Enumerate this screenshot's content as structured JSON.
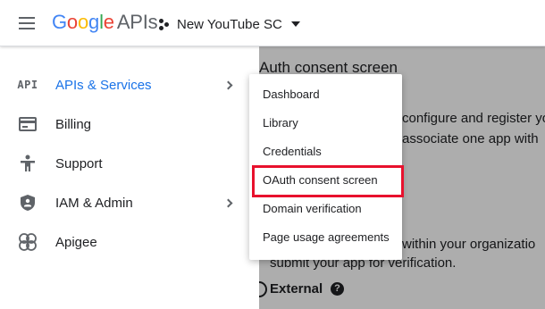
{
  "header": {
    "logo": {
      "g1": "G",
      "g2": "o",
      "g3": "o",
      "g4": "g",
      "g5": "l",
      "g6": "e",
      "apis": "APIs"
    },
    "project_name": "New YouTube SC"
  },
  "sidebar": {
    "items": [
      {
        "label": "APIs & Services",
        "icon": "API",
        "active": true,
        "has_submenu": true
      },
      {
        "label": "Billing",
        "icon": "billing-icon",
        "has_submenu": false
      },
      {
        "label": "Support",
        "icon": "support-icon",
        "has_submenu": false
      },
      {
        "label": "IAM & Admin",
        "icon": "shield-icon",
        "has_submenu": true
      },
      {
        "label": "Apigee",
        "icon": "apigee-icon",
        "has_submenu": false
      }
    ]
  },
  "submenu": {
    "items": [
      {
        "label": "Dashboard"
      },
      {
        "label": "Library"
      },
      {
        "label": "Credentials"
      },
      {
        "label": "OAuth consent screen",
        "highlighted": true
      },
      {
        "label": "Domain verification"
      },
      {
        "label": "Page usage agreements"
      }
    ]
  },
  "main": {
    "title_fragment": "Auth consent screen",
    "text_1": "configure and register yo",
    "text_2": "associate one app with",
    "text_3": "within your organizatio",
    "text_4": "submit your app for verification.",
    "external_label": "External",
    "help_glyph": "?"
  },
  "colors": {
    "accent": "#1a73e8",
    "highlight_box": "#e8112d",
    "overlay": "rgba(0,0,0,0.32)"
  }
}
